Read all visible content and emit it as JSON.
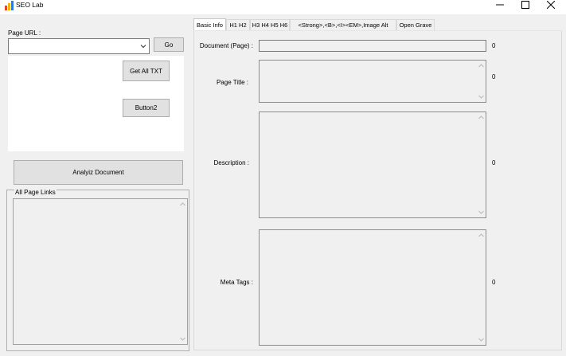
{
  "window": {
    "title": "SEO Lab",
    "icon": "seo-lab-app-icon",
    "controls": [
      "minimize",
      "maximize",
      "close"
    ]
  },
  "left": {
    "page_url_label": "Page URL :",
    "url_value": "",
    "go_label": "Go",
    "get_all_txt_label": "Get All TXT",
    "button2_label": "Button2",
    "analyze_label": "Analyiz Document",
    "all_page_links_label": "All Page Links"
  },
  "tabs": [
    {
      "label": "Basic Info",
      "active": true
    },
    {
      "label": "H1 H2",
      "active": false
    },
    {
      "label": "H3 H4 H5 H6",
      "active": false
    },
    {
      "label": "<Strong>,<B>,<I><EM>,Image Alt",
      "active": false
    },
    {
      "label": "Open Grave",
      "active": false
    }
  ],
  "basic_info": {
    "document": {
      "label": "Document (Page) :",
      "value": "",
      "count": "0"
    },
    "page_title": {
      "label": "Page Title :",
      "value": "",
      "count": "0"
    },
    "description": {
      "label": "Description :",
      "value": "",
      "count": "0"
    },
    "meta_tags": {
      "label": "Meta Tags :",
      "value": "",
      "count": "0"
    }
  },
  "colors": {
    "window_bg": "#f0f0f0",
    "button_bg": "#e1e1e1",
    "button_border": "#adadad",
    "field_border": "#8d8d8d"
  }
}
